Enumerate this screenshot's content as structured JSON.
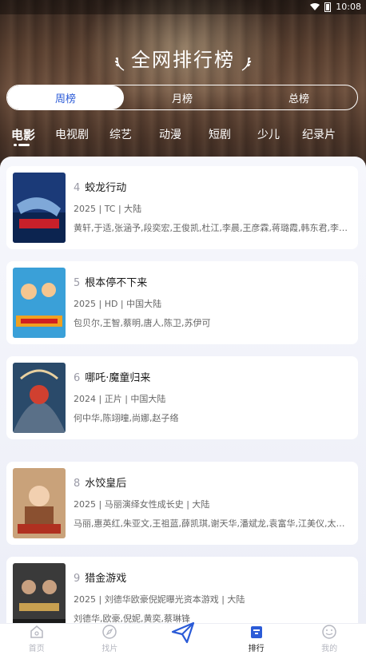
{
  "status": {
    "time": "10:08"
  },
  "header": {
    "title": "全网排行榜"
  },
  "period_tabs": [
    {
      "label": "周榜",
      "active": true
    },
    {
      "label": "月榜",
      "active": false
    },
    {
      "label": "总榜",
      "active": false
    }
  ],
  "categories": [
    {
      "label": "电影",
      "active": true
    },
    {
      "label": "电视剧"
    },
    {
      "label": "综艺"
    },
    {
      "label": "动漫"
    },
    {
      "label": "短剧"
    },
    {
      "label": "少儿"
    },
    {
      "label": "纪录片"
    }
  ],
  "list": [
    {
      "rank": "4",
      "title": "蛟龙行动",
      "meta": "2025 | TC | 大陆",
      "cast": "黄轩,于适,张涵予,段奕宏,王俊凯,杜江,李晨,王彦霖,蒋璐霞,韩东君,李…",
      "poster_colors": [
        "#1b3a78",
        "#c8202a"
      ]
    },
    {
      "rank": "5",
      "title": "根本停不下来",
      "meta": "2025 | HD | 中国大陆",
      "cast": "包贝尔,王智,蔡明,唐人,陈卫,苏伊可",
      "poster_colors": [
        "#3aa0d8",
        "#f0a020"
      ]
    },
    {
      "rank": "6",
      "title": "哪吒·魔童归来",
      "meta": "2024 | 正片 | 中国大陆",
      "cast": "何中华,陈翊曈,尚娜,赵子络",
      "poster_colors": [
        "#2a4a6a",
        "#d04030"
      ]
    },
    {
      "rank": "8",
      "title": "水饺皇后",
      "meta": "2025 | 马丽演绎女性成长史 | 大陆",
      "cast": "马丽,惠英红,朱亚文,王祖蓝,薛凯琪,谢天华,潘斌龙,袁富华,江美仪,太…",
      "poster_colors": [
        "#c9a27a",
        "#b03020"
      ]
    },
    {
      "rank": "9",
      "title": "猎金游戏",
      "meta": "2025 | 刘德华欧豪倪妮曝光资本游戏 | 大陆",
      "cast": "刘德华,欧豪,倪妮,黄奕,蔡琳锋",
      "poster_colors": [
        "#3a3a3a",
        "#c8a050"
      ]
    }
  ],
  "bottom_nav": [
    {
      "label": "首页",
      "icon": "home-icon"
    },
    {
      "label": "找片",
      "icon": "compass-icon"
    },
    {
      "label": "",
      "icon": "paper-plane-icon"
    },
    {
      "label": "排行",
      "icon": "ranking-icon",
      "active": true
    },
    {
      "label": "我的",
      "icon": "smile-icon"
    }
  ]
}
